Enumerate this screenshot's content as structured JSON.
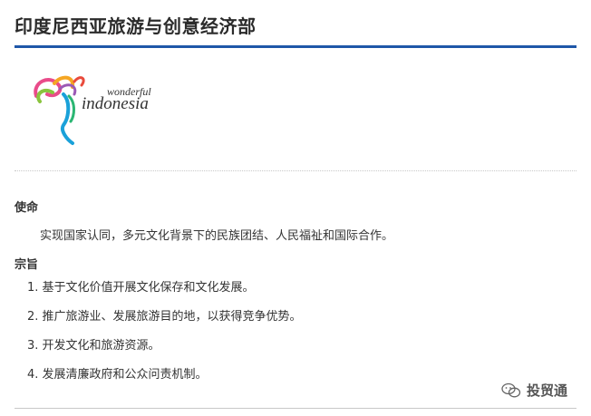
{
  "header": {
    "title": "印度尼西亚旅游与创意经济部"
  },
  "logo": {
    "line1": "wonderful",
    "line2": "indonesia"
  },
  "mission": {
    "label": "使命",
    "text": "实现国家认同，多元文化背景下的民族团结、人民福祉和国际合作。"
  },
  "purpose": {
    "label": "宗旨",
    "items": [
      "1. 基于文化价值开展文化保存和文化发展。",
      "2. 推广旅游业、发展旅游目的地，以获得竞争优势。",
      "3. 开发文化和旅游资源。",
      "4. 发展清廉政府和公众问责机制。"
    ]
  },
  "watermark": {
    "icon": "wechat-icon",
    "text": "投贸通"
  },
  "colors": {
    "accent": "#1f57a8"
  }
}
